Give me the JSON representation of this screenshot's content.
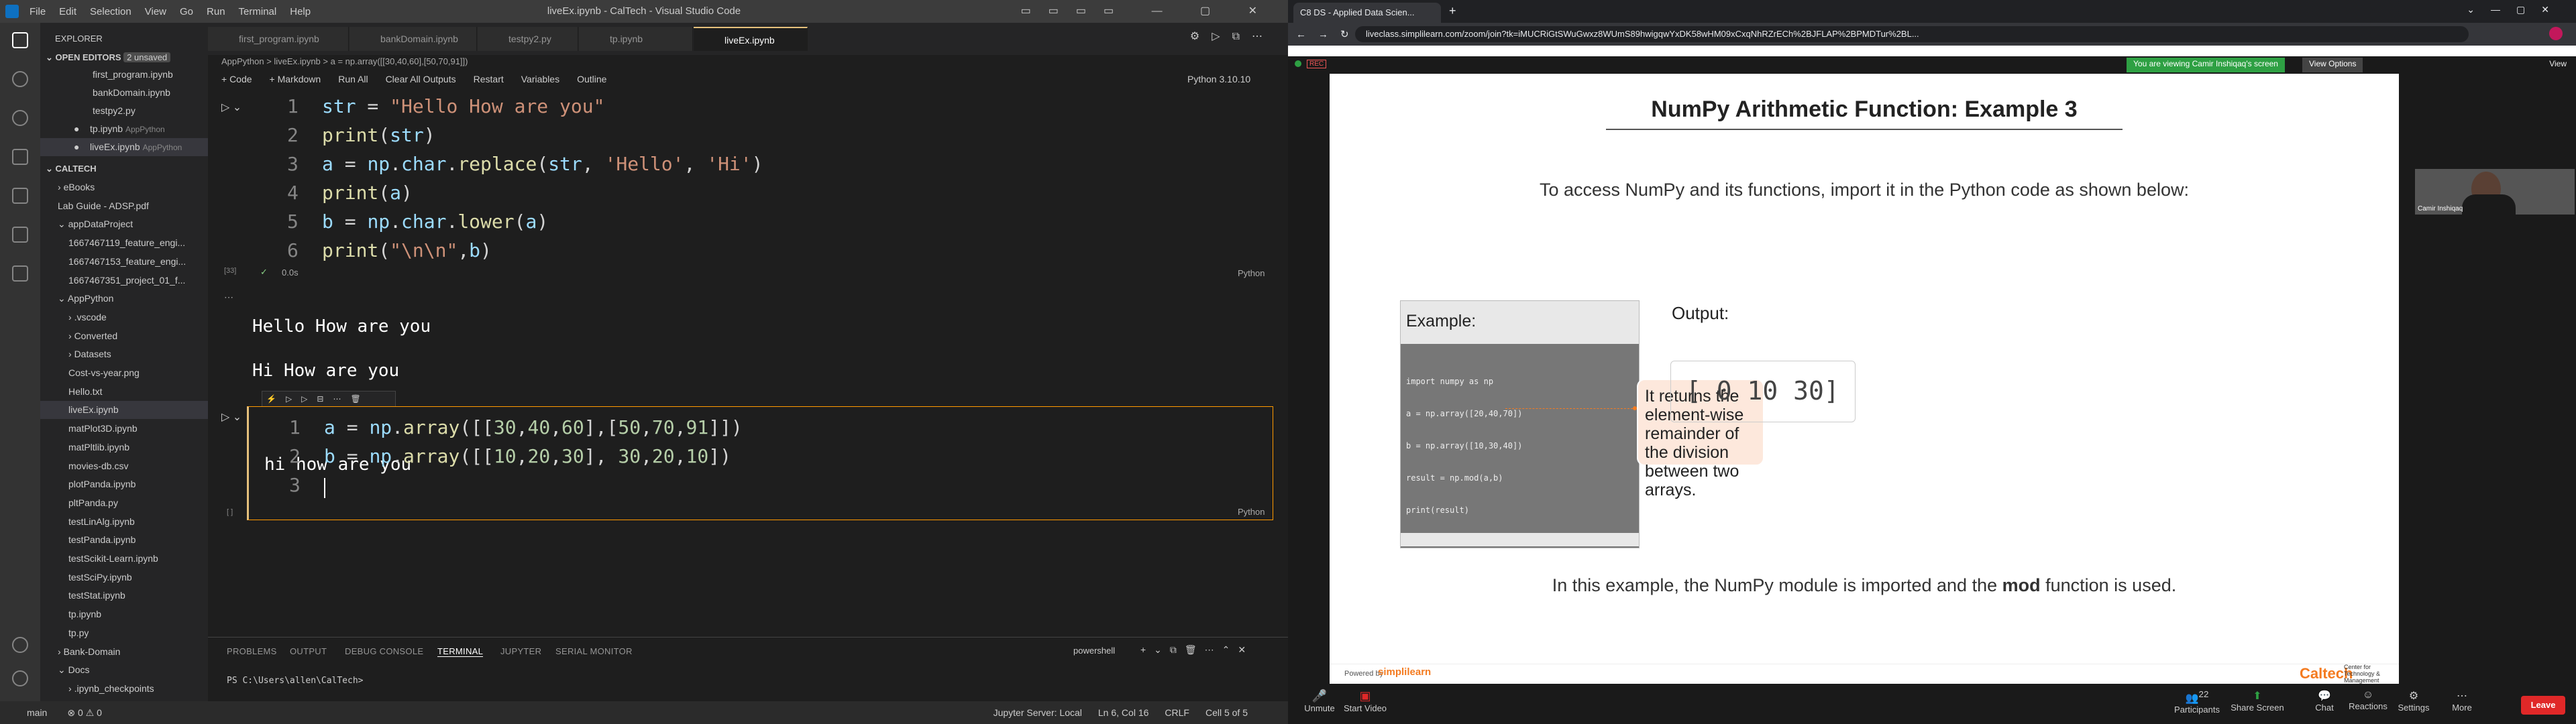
{
  "vscode": {
    "title": "liveEx.ipynb - CalTech - Visual Studio Code",
    "menu": [
      "File",
      "Edit",
      "Selection",
      "View",
      "Go",
      "Run",
      "Terminal",
      "Help"
    ],
    "explorer_header": "EXPLORER",
    "open_editors": "OPEN EDITORS",
    "unsaved": "2 unsaved",
    "open_files": [
      "first_program.ipynb",
      "bankDomain.ipynb",
      "testpy2.py",
      "tp.ipynb",
      "liveEx.ipynb"
    ],
    "open_suffix": [
      "",
      "",
      "",
      "AppPython",
      "AppPython"
    ],
    "caltech_folder": "CALTECH",
    "tree": [
      "eBooks",
      "Lab Guide - ADSP.pdf",
      "appDataProject",
      "1667467119_feature_engi...",
      "1667467153_feature_engi...",
      "1667467351_project_01_f...",
      "AppPython",
      ".vscode",
      "Converted",
      "Datasets",
      "Cost-vs-year.png",
      "Hello.txt",
      "liveEx.ipynb",
      "matPlot3D.ipynb",
      "matPltlib.ipynb",
      "movies-db.csv",
      "plotPanda.ipynb",
      "pltPanda.py",
      "testLinAlg.ipynb",
      "testPanda.ipynb",
      "testScikit-Learn.ipynb",
      "testSciPy.ipynb",
      "testStat.ipynb",
      "tp.ipynb",
      "tp.py",
      "Bank-Domain",
      "Docs",
      ".ipynb_checkpoints"
    ],
    "tabs": [
      "first_program.ipynb",
      "bankDomain.ipynb",
      "testpy2.py",
      "tp.ipynb",
      "liveEx.ipynb"
    ],
    "breadcrumb": "AppPython  >  liveEx.ipynb  >  a = np.array([[30,40,60],[50,70,91]])",
    "toolbar": [
      "+ Code",
      "+ Markdown",
      "Run All",
      "Clear All Outputs",
      "Restart",
      "Variables",
      "Outline"
    ],
    "kernel": "Python 3.10.10",
    "cell1_lines": [
      "str = \"Hello How are you\"",
      "print(str)",
      "a = np.char.replace(str, 'Hello', 'Hi')",
      "print(a)",
      "b = np.char.lower(a)",
      "print(\"\\n\\n\",b)"
    ],
    "cell1_exec": "[33]",
    "cell1_time": "0.0s",
    "lang": "Python",
    "output_lines": [
      "Hello How are you",
      "Hi How are you",
      "",
      "hi how are you"
    ],
    "cell2_lines": [
      "a = np.array([[30,40,60],[50,70,91]])",
      "b = np.array([[10,20,30], 30,20,10])",
      ""
    ],
    "cell2_exec": "[ ]",
    "panel_tabs": [
      "PROBLEMS",
      "OUTPUT",
      "DEBUG CONSOLE",
      "TERMINAL",
      "JUPYTER",
      "SERIAL MONITOR"
    ],
    "terminal_shell": "powershell",
    "terminal_prompt": "PS C:\\Users\\allen\\CalTech>",
    "status_left": [
      "main",
      "⊗ 0 ⚠ 0"
    ],
    "status_right": [
      "Jupyter Server: Local",
      "Ln 6, Col 16",
      "CRLF",
      "Cell 5 of 5"
    ]
  },
  "chrome": {
    "tab_title": "C8 DS - Applied Data Scien...",
    "url": "liveclass.simplilearn.com/zoom/join?tk=iMUCRiGtSWuGwxz8WUmS89hwigqwYxDK58wHM09xCxqNhRZrECh%2BJFLAP%2BPMDTur%2BL...",
    "recording": "REC",
    "viewing": "You are viewing Camir Inshiqaq's screen",
    "view_options": "View Options",
    "view_label": "View"
  },
  "slide": {
    "title": "NumPy Arithmetic Function: Example 3",
    "intro": "To access NumPy and its functions, import it in the Python code as shown below:",
    "example_label": "Example:",
    "code_lines": [
      "import numpy as np",
      "a = np.array([20,40,70])",
      "b = np.array([10,30,40])",
      "result = np.mod(a,b)",
      "print(result)"
    ],
    "callout": "It returns the element-wise remainder of the division between two arrays.",
    "output_label": "Output:",
    "output_value": "[ 0 10 30]",
    "bottom_pre": "In this example, the NumPy module is imported and the ",
    "bottom_bold": "mod",
    "bottom_post": " function is used.",
    "powered_by": "Powered by",
    "simplilearn": "simplilearn",
    "caltech": "Caltech",
    "caltech_sub": "Center for Technology & Management Education"
  },
  "participant": {
    "name": "Camir Inshiqaq"
  },
  "zoom_controls": {
    "mute": "Unmute",
    "video": "Start Video",
    "buttons": [
      "Participants",
      "Share Screen",
      "Chat",
      "Reactions",
      "Settings",
      "More"
    ],
    "participants_count": "22",
    "leave": "Leave"
  },
  "colors": {
    "accent": "#0e70c0",
    "orange": "#f47b20",
    "red_leave": "#e02828"
  }
}
